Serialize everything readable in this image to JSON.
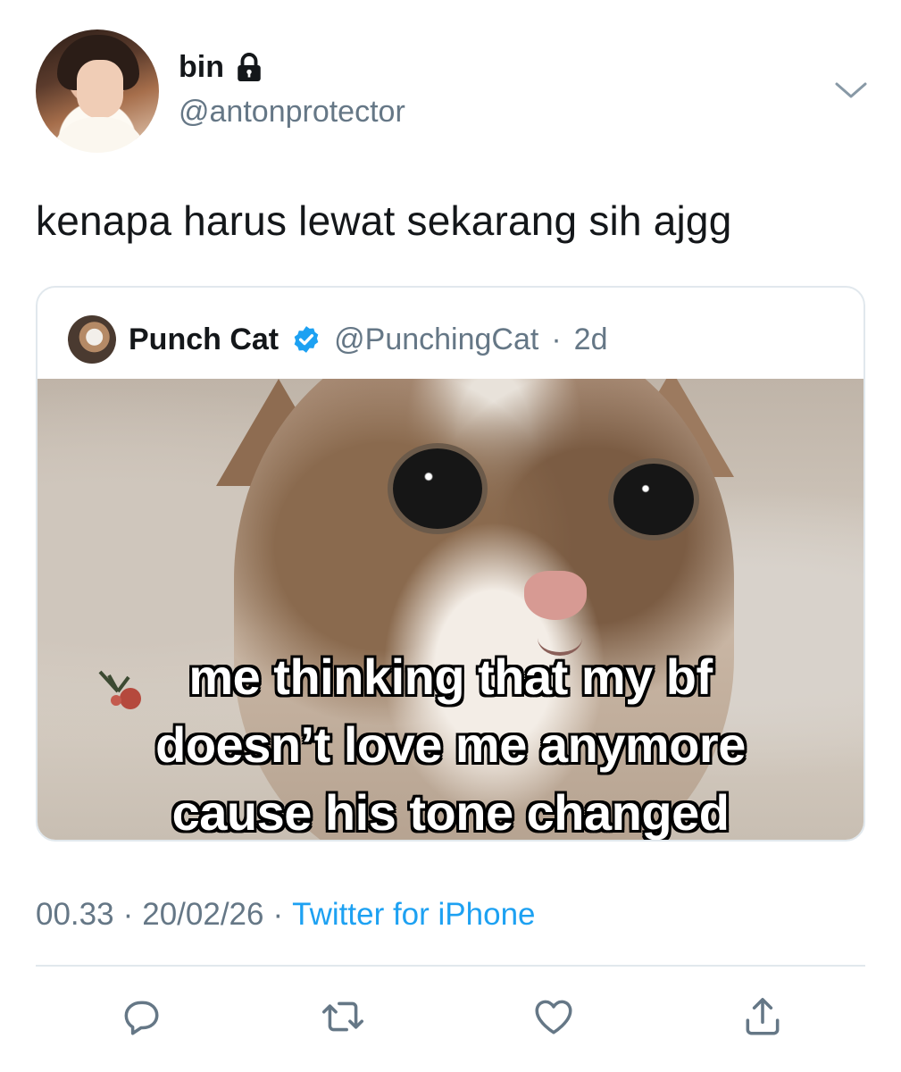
{
  "author": {
    "display_name": "bin",
    "handle": "@antonprotector",
    "protected": true
  },
  "tweet": {
    "text": "kenapa harus lewat sekarang sih ajgg"
  },
  "quoted_tweet": {
    "display_name": "Punch Cat",
    "verified": true,
    "handle": "@PunchingCat",
    "separator": "·",
    "age": "2d",
    "media_caption_lines": [
      "me thinking that my bf",
      "doesn’t love me anymore",
      "cause his tone changed"
    ]
  },
  "meta": {
    "time": "00.33",
    "separator": "·",
    "date": "20/02/26",
    "source": "Twitter for iPhone"
  },
  "icons": {
    "menu": "chevron-down-icon",
    "lock": "lock-icon",
    "verified": "verified-badge-icon",
    "reply": "reply-icon",
    "retweet": "retweet-icon",
    "like": "heart-icon",
    "share": "share-icon"
  },
  "colors": {
    "text_primary": "#14171a",
    "text_secondary": "#657786",
    "link": "#1da1f2",
    "border": "#e1e8ed",
    "icon": "#657786"
  }
}
